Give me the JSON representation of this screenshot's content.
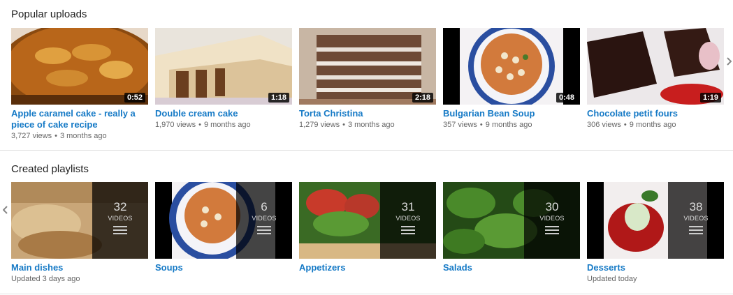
{
  "popular": {
    "title": "Popular uploads",
    "videos": [
      {
        "title": "Apple caramel cake - really a piece of cake recipe",
        "duration": "0:52",
        "views": "3,727 views",
        "age": "3 months ago"
      },
      {
        "title": "Double cream cake",
        "duration": "1:18",
        "views": "1,970 views",
        "age": "9 months ago"
      },
      {
        "title": "Torta Christina",
        "duration": "2:18",
        "views": "1,279 views",
        "age": "3 months ago"
      },
      {
        "title": "Bulgarian Bean Soup",
        "duration": "0:48",
        "views": "357 views",
        "age": "9 months ago"
      },
      {
        "title": "Chocolate petit fours",
        "duration": "1:19",
        "views": "306 views",
        "age": "9 months ago"
      }
    ],
    "separator": "•",
    "next_icon": "chevron-right-icon"
  },
  "playlists": {
    "title": "Created playlists",
    "video_label": "VIDEOS",
    "prev_icon": "chevron-left-icon",
    "items": [
      {
        "title": "Main dishes",
        "count": "32",
        "updated": "Updated 3 days ago"
      },
      {
        "title": "Soups",
        "count": "6",
        "updated": ""
      },
      {
        "title": "Appetizers",
        "count": "31",
        "updated": ""
      },
      {
        "title": "Salads",
        "count": "30",
        "updated": ""
      },
      {
        "title": "Desserts",
        "count": "38",
        "updated": "Updated today"
      }
    ]
  },
  "colors": {
    "link": "#167ac6",
    "meta": "#666666"
  }
}
